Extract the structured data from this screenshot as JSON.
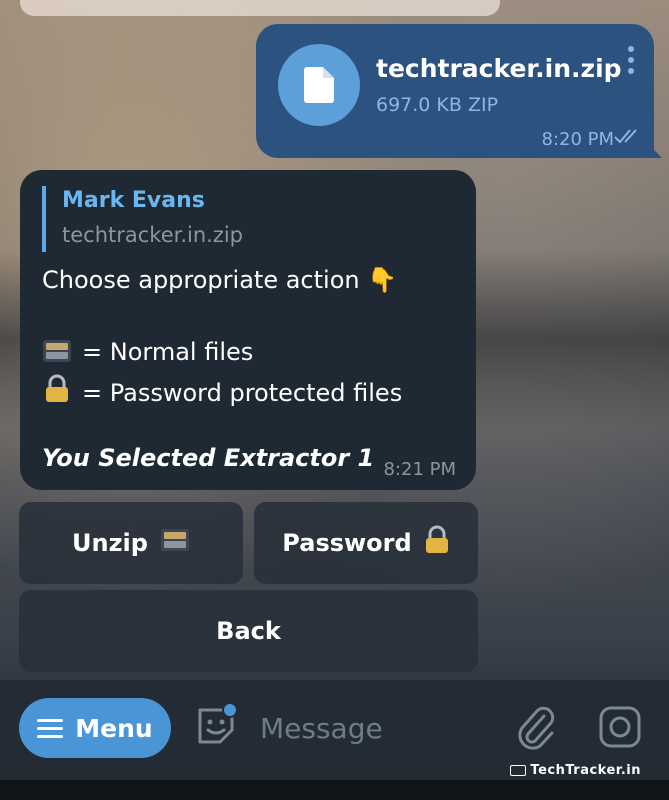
{
  "outgoing": {
    "file_name": "techtracker.in.zip",
    "file_meta": "697.0 KB ZIP",
    "time": "8:20 PM",
    "status_icon": "double-check-icon",
    "bubble_color": "#2c5280"
  },
  "incoming": {
    "reply_to": {
      "sender": "Mark Evans",
      "file": "techtracker.in.zip"
    },
    "lines": {
      "heading": "Choose appropriate action 👇",
      "normal": "= Normal files",
      "password": "= Password protected files",
      "selected": "You Selected Extractor 1"
    },
    "time": "8:21 PM"
  },
  "keyboard": {
    "unzip_label": "Unzip",
    "password_label": "Password",
    "back_label": "Back"
  },
  "input_bar": {
    "menu_label": "Menu",
    "placeholder": "Message",
    "accent": "#4a95d6"
  },
  "watermark": "TechTracker.in"
}
